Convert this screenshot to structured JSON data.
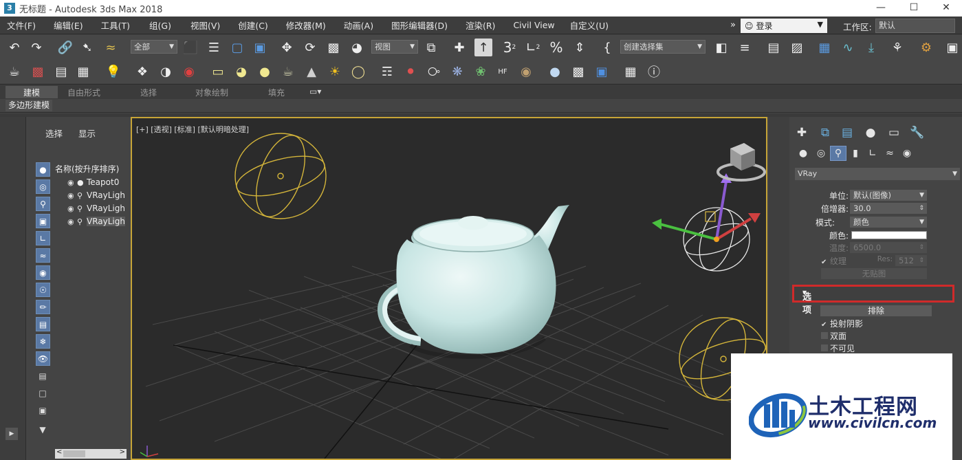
{
  "window": {
    "title": "无标题 - Autodesk 3ds Max 2018",
    "app_icon": "3"
  },
  "menu": [
    "文件(F)",
    "编辑(E)",
    "工具(T)",
    "组(G)",
    "视图(V)",
    "创建(C)",
    "修改器(M)",
    "动画(A)",
    "图形编辑器(D)",
    "渲染(R)",
    "Civil View",
    "自定义(U)"
  ],
  "menu_overflow": "»",
  "login": {
    "label": "登录",
    "icon": "user-icon"
  },
  "workspace": {
    "label": "工作区:",
    "value": "默认"
  },
  "toolbar": {
    "selection_filter": "全部",
    "ref_coord": "视图",
    "named_selection": "创建选择集",
    "snap_label": "3",
    "snap_sup": "2",
    "angle_sup": "2",
    "percent": "%"
  },
  "ribbon": {
    "tabs": [
      "建模",
      "自由形式",
      "选择",
      "对象绘制",
      "填充"
    ],
    "panel_button": "多边形建模"
  },
  "explorer": {
    "tabs": [
      "选择",
      "显示"
    ],
    "list_header": "名称(按升序排序)",
    "objects": [
      {
        "name": "Teapot0",
        "kind": "●"
      },
      {
        "name": "VRayLigh",
        "kind": "💡"
      },
      {
        "name": "VRayLigh",
        "kind": "💡"
      },
      {
        "name": "VRayLigh",
        "kind": "💡"
      }
    ]
  },
  "viewport": {
    "label": "[+] [透视] [标准] [默认明暗处理]"
  },
  "command_panel": {
    "object_type": "VRay",
    "unit_label": "单位:",
    "unit_value": "默认(图像)",
    "multiplier_label": "倍增器:",
    "multiplier_value": "30.0",
    "mode_label": "模式:",
    "mode_value": "颜色",
    "color_label": "颜色:",
    "color_value": "#ffffff",
    "temperature_label": "温度:",
    "temperature_value": "6500.0",
    "texture_label": "纹理",
    "res_label": "Res:",
    "res_value": "512",
    "no_map": "无贴图",
    "options_rollout": "选项",
    "exclude_button": "排除",
    "cast_shadows": "投射阴影",
    "double_sided": "双面",
    "invisible": "不可见"
  },
  "watermark": {
    "name": "土木工程网",
    "url": "www.civilcn.com"
  },
  "colors": {
    "viewport_border": "#c7a537",
    "highlight_box": "#d02a2a",
    "light_gizmo": "#d4b53a",
    "teapot": "#c9e6e4"
  }
}
